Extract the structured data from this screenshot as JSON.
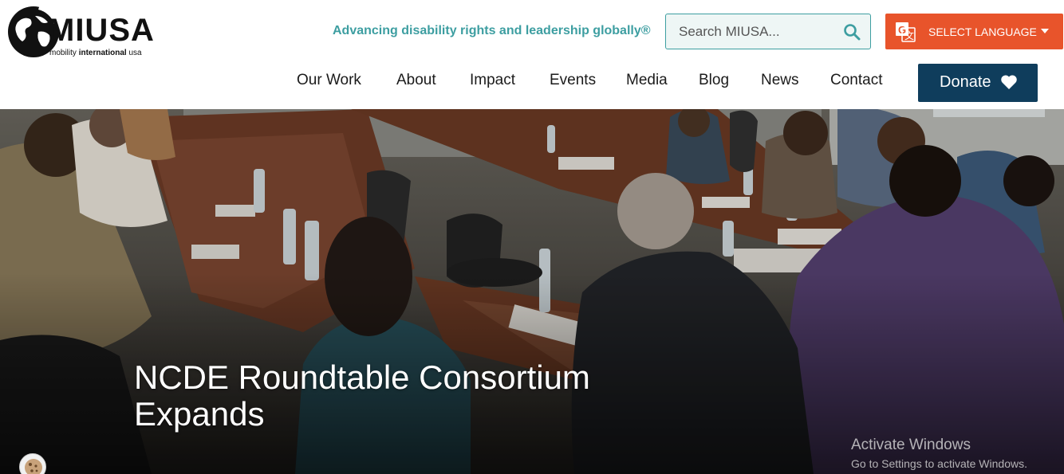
{
  "logo": {
    "wordmark": "MIUSA",
    "subtitle_light": "mobility ",
    "subtitle_bold": "international",
    "subtitle_end": " usa"
  },
  "header": {
    "tagline": "Advancing disability rights and leadership globally®",
    "search_placeholder": "Search MIUSA...",
    "language_label": "SELECT LANGUAGE",
    "donate_label": "Donate"
  },
  "nav": {
    "items": [
      "Our Work",
      "About",
      "Impact",
      "Events",
      "Media",
      "Blog",
      "News",
      "Contact"
    ]
  },
  "hero": {
    "title_line1": "NCDE Roundtable Consortium",
    "title_line2": "Expands"
  },
  "os_watermark": {
    "line1": "Activate Windows",
    "line2": "Go to Settings to activate Windows."
  },
  "colors": {
    "teal": "#3d9ea1",
    "orange": "#e8542b",
    "navy": "#0f3d5c"
  },
  "icons": [
    "globe-logo-icon",
    "search-icon",
    "translate-icon",
    "caret-down-icon",
    "heart-icon",
    "cookie-icon"
  ]
}
